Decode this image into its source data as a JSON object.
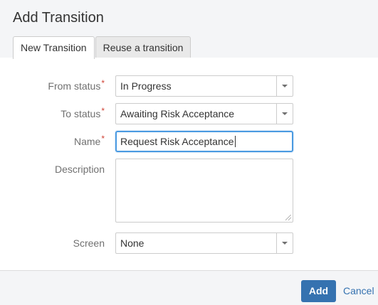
{
  "dialog": {
    "title": "Add Transition"
  },
  "tabs": [
    {
      "label": "New Transition",
      "active": true
    },
    {
      "label": "Reuse a transition",
      "active": false
    }
  ],
  "form": {
    "from_status": {
      "label": "From status",
      "required_mark": "*",
      "value": "In Progress"
    },
    "to_status": {
      "label": "To status",
      "required_mark": "*",
      "value": "Awaiting Risk Acceptance"
    },
    "name": {
      "label": "Name",
      "required_mark": "*",
      "value": "Request Risk Acceptance"
    },
    "description": {
      "label": "Description",
      "value": ""
    },
    "screen": {
      "label": "Screen",
      "value": "None"
    }
  },
  "footer": {
    "add_label": "Add",
    "cancel_label": "Cancel"
  },
  "colors": {
    "primary": "#3572b0",
    "required": "#d04437",
    "focus_border": "#4a9ae1"
  }
}
